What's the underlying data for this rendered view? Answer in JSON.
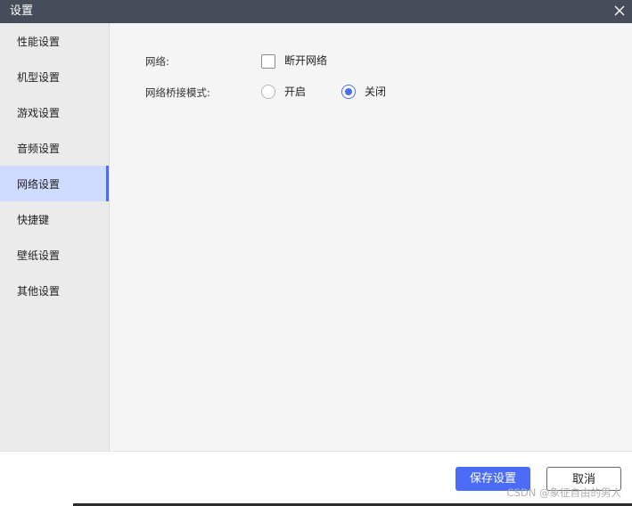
{
  "window": {
    "title": "设置"
  },
  "sidebar": {
    "items": [
      {
        "label": "性能设置"
      },
      {
        "label": "机型设置"
      },
      {
        "label": "游戏设置"
      },
      {
        "label": "音频设置"
      },
      {
        "label": "网络设置",
        "active": true
      },
      {
        "label": "快捷键"
      },
      {
        "label": "壁纸设置"
      },
      {
        "label": "其他设置"
      }
    ]
  },
  "network": {
    "network_label": "网络:",
    "disconnect_label": "断开网络",
    "disconnect_checked": false,
    "bridge_label": "网络桥接模式:",
    "bridge_options": [
      {
        "label": "开启",
        "selected": false
      },
      {
        "label": "关闭",
        "selected": true
      }
    ]
  },
  "footer": {
    "save_label": "保存设置",
    "cancel_label": "取消"
  },
  "watermark": "CSDN @象征自由的男人",
  "colors": {
    "titlebar": "#474c5a",
    "accent": "#4a6cf7",
    "sidebar_active": "#cfdbff",
    "content_bg": "#f5f5f5",
    "sidebar_bg": "#ebebeb"
  }
}
